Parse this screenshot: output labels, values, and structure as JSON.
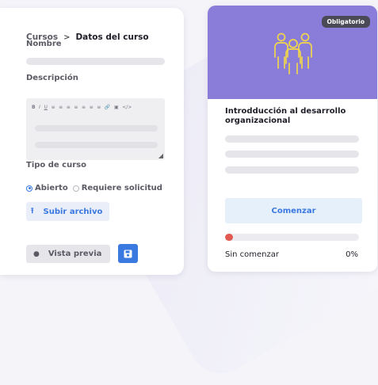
{
  "breadcrumb": {
    "parent": "Cursos",
    "separator": ">",
    "current": "Datos del curso"
  },
  "form": {
    "name_label": "Nombre",
    "description_label": "Descripción",
    "toolbar_icons": [
      "B",
      "I",
      "U",
      "≡",
      "≡",
      "≡",
      "≡",
      "≡",
      "≡",
      "≡",
      "🔗",
      "▣",
      "</>"
    ],
    "type_label": "Tipo de curso",
    "type_options": [
      {
        "label": "Abierto",
        "selected": true
      },
      {
        "label": "Requiere solicitud",
        "selected": false
      }
    ],
    "upload_label": "Subir archivo",
    "preview_label": "Vista previa",
    "save_icon": "floppy-disk-icon"
  },
  "course": {
    "badge": "Obligatorio",
    "title": "Introdducción al desarrollo organizacional",
    "start_label": "Comenzar",
    "progress": 0.06,
    "status": "Sin comenzar",
    "percent": "0%"
  },
  "colors": {
    "accent": "#3a79e0",
    "header": "#8a7dd9",
    "progress": "#e05a52",
    "icon": "#f2d64a"
  }
}
